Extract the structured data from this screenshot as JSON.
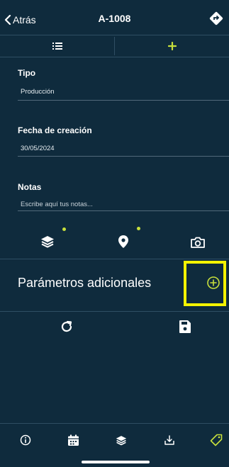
{
  "header": {
    "back_label": "Atrás",
    "title": "A-1008",
    "right_icon": "navigation-diamond-icon"
  },
  "tabs": [
    {
      "icon": "list-icon",
      "active": false
    },
    {
      "icon": "plus-icon",
      "active": true
    }
  ],
  "form": {
    "tipo": {
      "label": "Tipo",
      "value": "Producción"
    },
    "fecha": {
      "label": "Fecha de creación",
      "value": "30/05/2024"
    },
    "notas": {
      "label": "Notas",
      "placeholder": "Escribe aquí tus notas..."
    }
  },
  "icon_row": [
    {
      "icon": "layers-icon",
      "indicator": true
    },
    {
      "icon": "location-pin-icon",
      "indicator": true
    },
    {
      "icon": "camera-icon",
      "indicator": false
    }
  ],
  "params": {
    "label": "Parámetros adicionales",
    "add_icon": "plus-circle-icon"
  },
  "actions": [
    {
      "icon": "refresh-icon"
    },
    {
      "icon": "save-icon"
    }
  ],
  "bottom_bar": [
    {
      "icon": "info-icon"
    },
    {
      "icon": "calendar-icon"
    },
    {
      "icon": "layers-icon"
    },
    {
      "icon": "download-icon"
    },
    {
      "icon": "tag-icon"
    }
  ],
  "colors": {
    "background": "#0f2b3d",
    "accent": "#c8e03c",
    "highlight": "#f4f300",
    "divider": "#2f4e63"
  }
}
